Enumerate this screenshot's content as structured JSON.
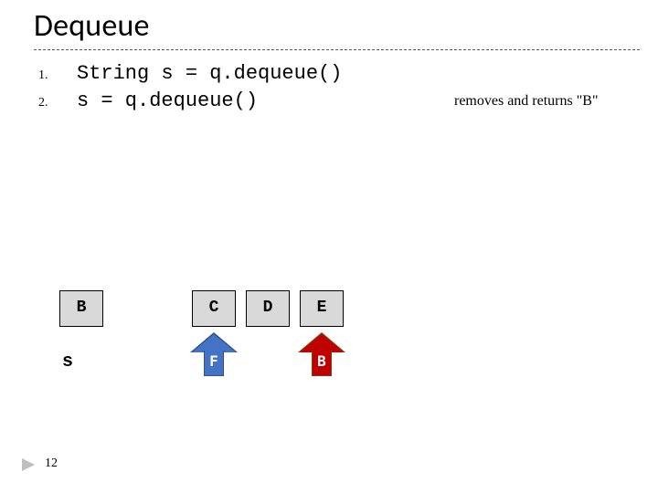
{
  "title": "Dequeue",
  "steps": [
    {
      "num": "1.",
      "code": "String s = q.dequeue()"
    },
    {
      "num": "2.",
      "code": "s = q.dequeue()"
    }
  ],
  "side_note": "removes and returns \"B\"",
  "boxes": {
    "detached": "B",
    "queue": [
      "C",
      "D",
      "E"
    ]
  },
  "s_label": "s",
  "arrows": {
    "front": {
      "label": "F",
      "color": "#4472c4",
      "stroke": "#2f528f"
    },
    "back": {
      "label": "B",
      "color": "#c00000",
      "stroke": "#843c0c"
    }
  },
  "page_number": "12"
}
